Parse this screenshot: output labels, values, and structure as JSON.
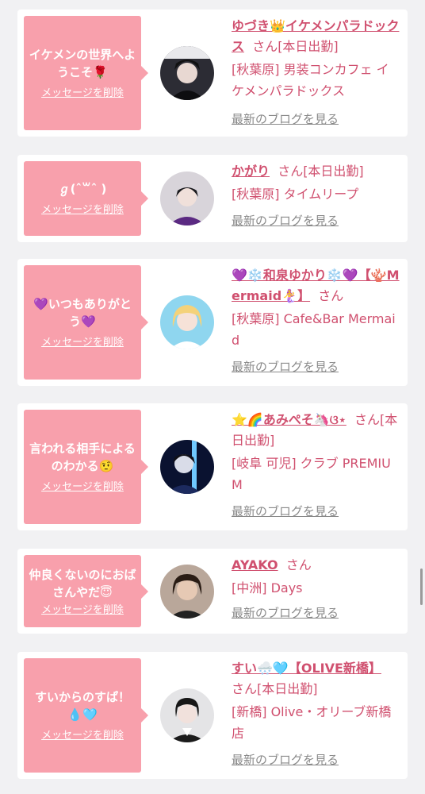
{
  "cards": [
    {
      "message": "イケメンの世界へようこそ🌹",
      "delete_label": "メッセージを削除",
      "name": "ゆづき👑イケメンパラドックス",
      "suffix": "さん[本日出勤]",
      "shop": "[秋葉原] 男装コンカフェ イケメンパラドックス",
      "blog_label": "最新のブログを見る"
    },
    {
      "message": "ℊ(ˆ꒳ˆ )",
      "delete_label": "メッセージを削除",
      "name": "かがり",
      "suffix": "さん[本日出勤]",
      "shop": "[秋葉原] タイムリープ",
      "blog_label": "最新のブログを見る"
    },
    {
      "message": "💜いつもありがとう💜",
      "delete_label": "メッセージを削除",
      "name": "💜❄️和泉ゆかり❄️💜【🪸Mermaid🧜‍♀️】",
      "suffix": "さん",
      "shop": "[秋葉原] Cafe&Bar Mermaid",
      "blog_label": "最新のブログを見る"
    },
    {
      "message": "言われる相手によるのわかる🤨",
      "delete_label": "メッセージを削除",
      "name": "⭐️🌈あみぺそ🦄ଓ⋆",
      "suffix": "さん[本日出勤]",
      "shop": "[岐阜 可児] クラブ PREMIUM",
      "blog_label": "最新のブログを見る"
    },
    {
      "message": "仲良くないのにおばさんやだ😇",
      "delete_label": "メッセージを削除",
      "name": "AYAKO",
      "suffix": "さん",
      "shop": "[中洲] Days",
      "blog_label": "最新のブログを見る"
    },
    {
      "message": "すいからのすぱ！💧🩵",
      "delete_label": "メッセージを削除",
      "name": "すい🌨️🩵【OLIVE新橋】",
      "suffix": "さん[本日出勤]",
      "shop": "[新橋] Olive・オリーブ新橋店",
      "blog_label": "最新のブログを見る"
    }
  ]
}
